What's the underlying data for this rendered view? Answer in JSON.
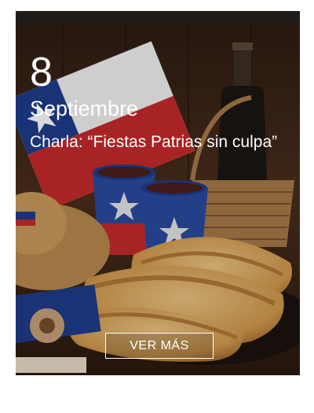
{
  "event": {
    "day": "8",
    "month": "Septiembre",
    "title": "Charla: “Fiestas Patrias sin culpa”",
    "cta_label": "VER MÁS"
  },
  "colors": {
    "flag_red": "#c62b2b",
    "flag_blue": "#1f3c8c",
    "flag_white": "#f2f2f2",
    "pastry": "#d9a55b",
    "wood": "#3a2416"
  }
}
